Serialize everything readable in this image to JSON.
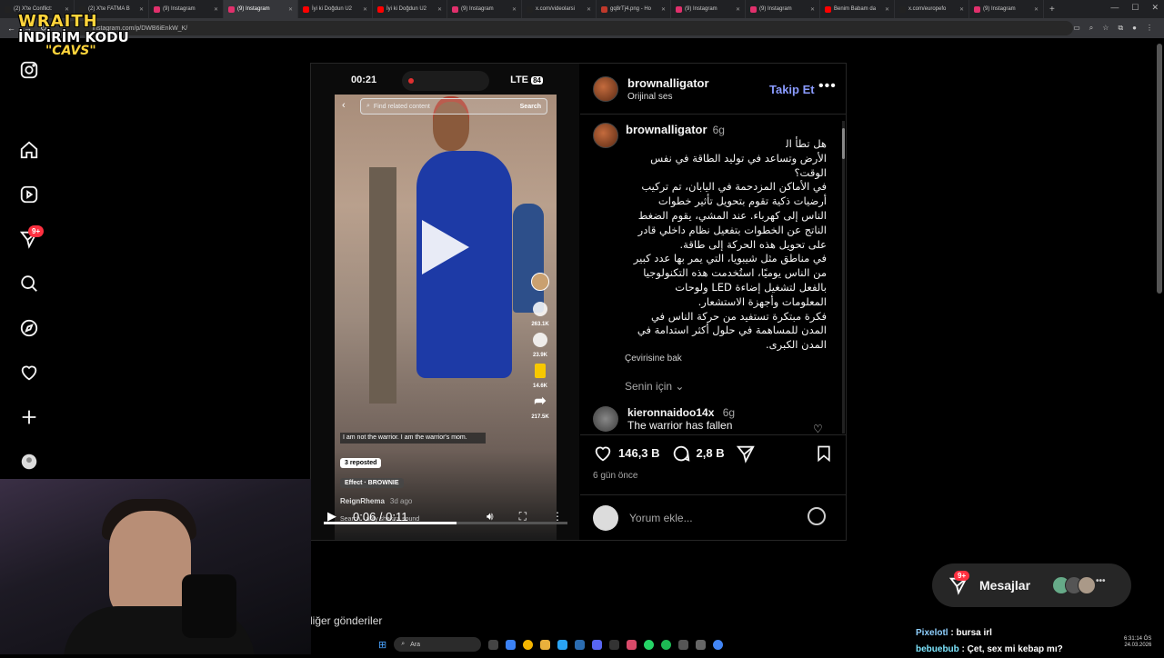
{
  "browser": {
    "tabs": [
      {
        "label": "(2) X'te Conflict: ",
        "color": "#222222",
        "active": false
      },
      {
        "label": "(2) X'te FATMA B",
        "color": "#222222",
        "active": false
      },
      {
        "label": "(9) Instagram",
        "color": "#e1306c",
        "active": false
      },
      {
        "label": "(9) Instagram",
        "color": "#e1306c",
        "active": true
      },
      {
        "label": "İyi ki Doğdun U2",
        "color": "#ff0000",
        "active": false
      },
      {
        "label": "İyi ki Doğdun U2",
        "color": "#ff0000",
        "active": false
      },
      {
        "label": "(9) Instagram",
        "color": "#e1306c",
        "active": false
      },
      {
        "label": "x.com/videolarsi",
        "color": "#222222",
        "active": false
      },
      {
        "label": "gq8rTj4.png - Ho",
        "color": "#c0392b",
        "active": false
      },
      {
        "label": "(9) Instagram",
        "color": "#e1306c",
        "active": false
      },
      {
        "label": "(9) Instagram",
        "color": "#e1306c",
        "active": false
      },
      {
        "label": "Benim Babam da",
        "color": "#ff0000",
        "active": false
      },
      {
        "label": "x.com/europefo",
        "color": "#222222",
        "active": false
      },
      {
        "label": "(9) Instagram",
        "color": "#e1306c",
        "active": false
      }
    ],
    "url": "instagram.com/p/DWB6iEnkW_K/"
  },
  "stream_overlay": {
    "brand": "WRAITH",
    "line1": "İNDİRİM KODU",
    "code": "\"CAVS\""
  },
  "sidebar": {
    "notification_badge": "9+"
  },
  "video": {
    "phone_time": "00:21",
    "phone_network": "LTE",
    "phone_battery": "84",
    "search_placeholder": "Find related content",
    "search_button": "Search",
    "likes": "263.1K",
    "comments": "23.9K",
    "saves": "14.6K",
    "shares": "217.5K",
    "caption": "I am not the warrior. I am the warrior's mom.",
    "reposted": "3 reposted",
    "effect": "Effect · BROWNIE",
    "creator": "ReignRhema",
    "creator_time": "3d ago",
    "sound_search": "Search · anty shakira sound",
    "time_display": "0:06 / 0:11",
    "progress": 0.545
  },
  "post": {
    "username": "brownalligator",
    "audio": "Orijinal ses",
    "follow_label": "Takip Et",
    "caption_time": "6g",
    "caption_text": "هل تطأ ﺍﻟ\nالأرض وتساعد في توليد الطاقة في نفس\nالوقت؟\nفي الأماكن المزدحمة في اليابان، تم تركيب\nأرضيات ذكية تقوم بتحويل تأثير خطوات\nالناس إلى كهرباء. عند المشي، يقوم الضغط\nالناتج عن الخطوات بتفعيل نظام داخلي قادر\nعلى تحويل هذه الحركة إلى طاقة.\nفي مناطق مثل شيبويا، التي يمر بها عدد كبير\nمن الناس يوميًا، استُخدمت هذه التكنولوجيا\nبالفعل لتشغيل إضاءة LED ولوحات\nالمعلومات وأجهزة الاستشعار.\nفكرة مبتكرة تستفيد من حركة الناس في\nالمدن للمساهمة في حلول أكثر استدامة في\nالمدن الكبرى.",
    "translate_label": "Çevirisine bak",
    "for_you_label": "Senin için",
    "comment2_user": "kieronnaidoo14x",
    "comment2_time": "6g",
    "comment2_text": "The warrior has fallen",
    "like_count": "146,3 B",
    "comment_count": "2,8 B",
    "date": "6 gün önce",
    "add_comment_placeholder": "Yorum ekle..."
  },
  "messages": {
    "label": "Mesajlar",
    "badge": "9+"
  },
  "more_from": "liğer gönderiler",
  "chat": [
    {
      "user": "Pixelotl",
      "text": "bursa irl"
    },
    {
      "user": "bebuebub",
      "text": "Çet, sex mi kebap mı?"
    }
  ],
  "taskbar": {
    "search": "Ara",
    "time": "6:31:14 ÖS",
    "date": "24.03.2026"
  },
  "colors": {
    "accent_blue": "#8a9bff",
    "badge_red": "#ff3040",
    "overlay_yellow": "#ffd43b"
  }
}
